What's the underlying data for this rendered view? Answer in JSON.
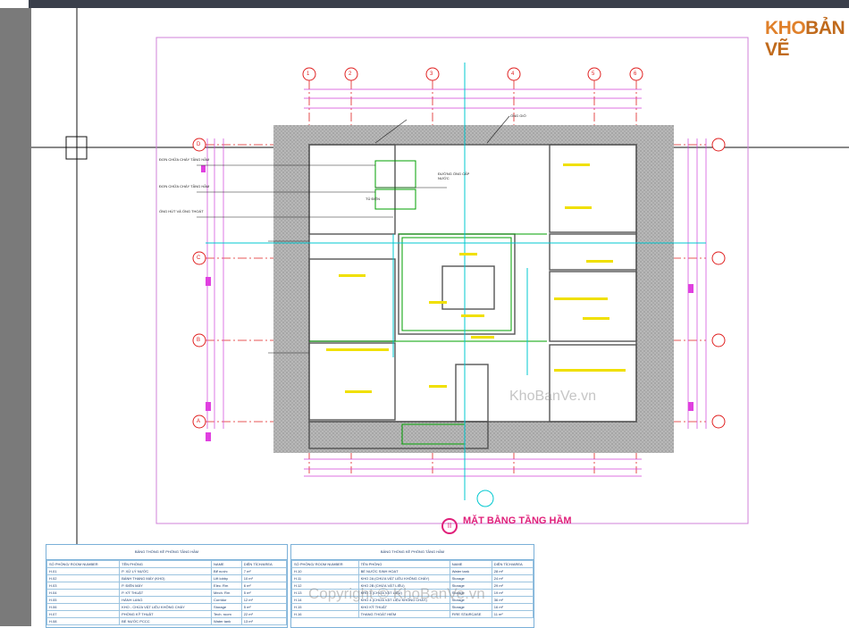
{
  "brand": {
    "logo_kho": "KHO",
    "logo_banve": "BẢN VẼ"
  },
  "watermarks": {
    "center": "KhoBanVe.vn",
    "footer": "Copyright © KhoBanVe.vn"
  },
  "plan": {
    "title": "MẶT BẰNG TẦNG HẦM",
    "title_marker": "II",
    "grid_columns": [
      "1",
      "2",
      "3",
      "4",
      "5",
      "6"
    ],
    "grid_rows": [
      "D",
      "C",
      "B",
      "A"
    ]
  },
  "annotations": [
    "ĐƠN CHỮA CHÁY TẦNG HẦM",
    "ĐƠN CHỮA CHÁY TẦNG HẦM",
    "ỐNG HÚT VÀ ỐNG THOÁT",
    "TỦ ĐIỆN",
    "ĐƯỜNG ỐNG CẤP NƯỚC",
    "ỐNG GIÓ"
  ],
  "colors": {
    "accent": "#e0207a",
    "cyan": "#00d0d0",
    "green": "#00a000",
    "yellow": "#f0e000",
    "wall": "#6a6a6a"
  },
  "table_left": {
    "caption": "BẢNG THỐNG KÊ PHÒNG TẦNG HẦM",
    "headers": [
      "SỐ PHÒNG/ ROOM NUMBER",
      "TÊN PHÒNG",
      "NAME",
      "DIỆN TÍCH/AREA"
    ],
    "rows": [
      [
        "H.01",
        "P. XỬ LÝ NƯỚC",
        "Bể nước",
        "7 m²"
      ],
      [
        "H.02",
        "BÁNH THANG MÁY (KHO)",
        "Lift lobby",
        "10 m²"
      ],
      [
        "H.03",
        "P. ĐIỆN MÁY",
        "Elec. Rm",
        "6 m²"
      ],
      [
        "H.04",
        "P. KỸ THUẬT",
        "Mech. Rm",
        "5 m²"
      ],
      [
        "H.05",
        "HÀNH LANG",
        "Corridor",
        "12 m²"
      ],
      [
        "H.06",
        "KHO - CHỨA VẬT LIỆU KHÔNG CHÁY",
        "Storage",
        "5 m²"
      ],
      [
        "H.07",
        "PHÒNG KỸ THUẬT",
        "Tech. room",
        "22 m²"
      ],
      [
        "H.08",
        "BỂ NƯỚC PCCC",
        "Water tank",
        "13 m²"
      ]
    ]
  },
  "table_right": {
    "caption": "BẢNG THỐNG KÊ PHÒNG TẦNG HẦM",
    "headers": [
      "SỐ PHÒNG/ ROOM NUMBER",
      "TÊN PHÒNG",
      "NAME",
      "DIỆN TÍCH/AREA"
    ],
    "rows": [
      [
        "H.10",
        "BỂ NƯỚC SINH HOẠT",
        "Water tank",
        "28 m²"
      ],
      [
        "H.11",
        "KHO 2A (CHỨA VẬT LIỆU KHÔNG CHÁY)",
        "Storage",
        "24 m²"
      ],
      [
        "H.12",
        "KHO 2B (CHỨA VẬT LIỆU)",
        "Storage",
        "29 m²"
      ],
      [
        "H.13",
        "KHO 3 (CHỨA VẬT LIỆU)",
        "Storage",
        "19 m²"
      ],
      [
        "H.14",
        "KHO 4 (CHỨA VẬT LIỆU KHÔNG CHÁY)",
        "Storage",
        "36 m²"
      ],
      [
        "H.15",
        "KHO KỸ THUẬT",
        "Storage",
        "16 m²"
      ],
      [
        "H.16",
        "THANG THOÁT HIỂM",
        "FIRE STAIRCASE",
        "11 m²"
      ]
    ]
  }
}
